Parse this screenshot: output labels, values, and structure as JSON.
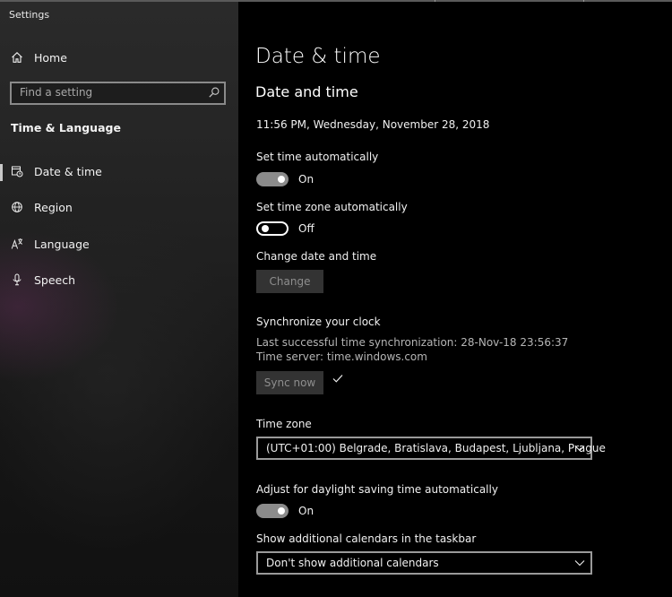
{
  "window": {
    "title": "Settings"
  },
  "sidebar": {
    "home_label": "Home",
    "search_placeholder": "Find a setting",
    "section_title": "Time & Language",
    "items": [
      {
        "label": "Date & time",
        "icon": "calendar-clock-icon",
        "selected": true
      },
      {
        "label": "Region",
        "icon": "globe-icon",
        "selected": false
      },
      {
        "label": "Language",
        "icon": "language-icon",
        "selected": false
      },
      {
        "label": "Speech",
        "icon": "microphone-icon",
        "selected": false
      }
    ]
  },
  "main": {
    "page_title": "Date & time",
    "section_title": "Date and time",
    "current_datetime": "11:56 PM, Wednesday, November 28, 2018",
    "set_time_auto": {
      "label": "Set time automatically",
      "state": "On"
    },
    "set_timezone_auto": {
      "label": "Set time zone automatically",
      "state": "Off"
    },
    "change_datetime": {
      "label": "Change date and time",
      "button": "Change"
    },
    "sync": {
      "title": "Synchronize your clock",
      "last_sync": "Last successful time synchronization: 28-Nov-18 23:56:37",
      "server": "Time server: time.windows.com",
      "button": "Sync now"
    },
    "timezone": {
      "label": "Time zone",
      "value": "(UTC+01:00) Belgrade, Bratislava, Budapest, Ljubljana, Prague"
    },
    "dst": {
      "label": "Adjust for daylight saving time automatically",
      "state": "On"
    },
    "calendars": {
      "label": "Show additional calendars in the taskbar",
      "value": "Don't show additional calendars"
    }
  },
  "colors": {
    "sidebar_bg": "#262626",
    "main_bg": "#000000",
    "toggle_on": "#8b8b8b",
    "disabled_button": "#333333"
  }
}
